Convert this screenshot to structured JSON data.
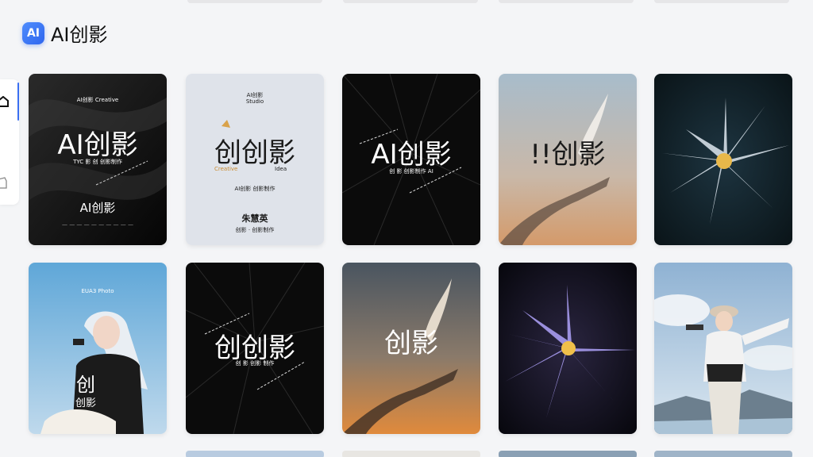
{
  "app": {
    "logo_text": "AI",
    "name": "AI创影"
  },
  "sidebar": {
    "items": [
      {
        "icon": "home-icon",
        "active": true
      },
      {
        "icon": "box-icon",
        "active": false
      }
    ],
    "accent": "#3a6ff2"
  },
  "cards": [
    {
      "theme": "dark-silk",
      "top_text": "AI创影 Creative",
      "title": "AI创影",
      "subtitle": "TYC 影 创 创影制作",
      "bottom_title": "AI创影",
      "footer": "— — — — — — — — — —"
    },
    {
      "theme": "light",
      "top_text": "AI创影",
      "top_text_2": "Studio",
      "title": "创创影",
      "left_label": "Creative",
      "right_label": "Idea",
      "subtitle": "AI创影 创影制作",
      "bottom_title": "朱慧英",
      "footer": "创影 · 创影制作"
    },
    {
      "theme": "black-rays",
      "title": "AI创影",
      "subtitle": "创 影 创影制作 AI"
    },
    {
      "theme": "sunset-hand",
      "title": "!!创影"
    },
    {
      "theme": "dark-flower"
    },
    {
      "theme": "girl-blue",
      "top_text": "EUA3 Photo",
      "shirt_text": "创",
      "shirt_text_2": "创影"
    },
    {
      "theme": "black-rays",
      "title": "创创影",
      "subtitle": "创 影 创影 制作"
    },
    {
      "theme": "sunset-hand",
      "title": "创影"
    },
    {
      "theme": "purple-flower"
    },
    {
      "theme": "girl-sky"
    }
  ]
}
